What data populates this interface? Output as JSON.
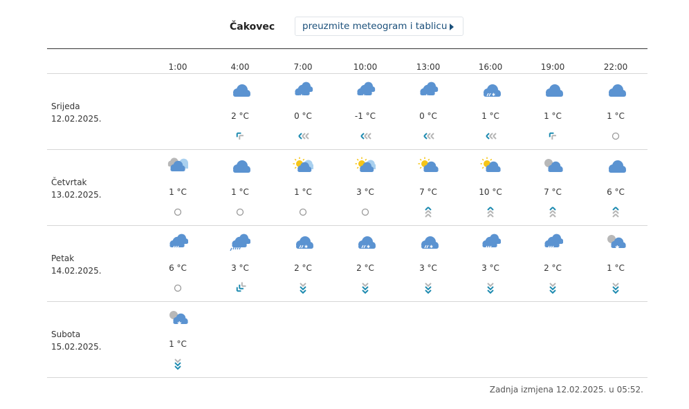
{
  "header": {
    "city": "Čakovec",
    "download_label": "preuzmite meteogram i tablicu"
  },
  "hours": [
    "1:00",
    "4:00",
    "7:00",
    "10:00",
    "13:00",
    "16:00",
    "19:00",
    "22:00"
  ],
  "colors": {
    "cloud": "#5b93d1",
    "sun": "#f5c518",
    "wind_teal": "#1e8bb0",
    "wind_grey": "#b5b5b5"
  },
  "days": [
    {
      "name": "Srijeda",
      "date": "12.02.2025.",
      "cells": [
        null,
        {
          "icon": "cloud-icon",
          "temp": "2 °C",
          "wind": "wind-northwest-icon"
        },
        {
          "icon": "cloudy-snow-icon",
          "temp": "0 °C",
          "wind": "wind-west-strong-icon"
        },
        {
          "icon": "cloudy-snow-icon",
          "temp": "-1 °C",
          "wind": "wind-west-strong-icon"
        },
        {
          "icon": "cloudy-snow-icon",
          "temp": "0 °C",
          "wind": "wind-west-strong-icon"
        },
        {
          "icon": "cloud-sleet-icon",
          "temp": "1 °C",
          "wind": "wind-west-strong-icon"
        },
        {
          "icon": "cloud-icon",
          "temp": "1 °C",
          "wind": "wind-northwest-icon"
        },
        {
          "icon": "cloud-icon",
          "temp": "1 °C",
          "wind": "calm-icon"
        }
      ]
    },
    {
      "name": "Četvrtak",
      "date": "13.02.2025.",
      "cells": [
        {
          "icon": "overcast-icon",
          "temp": "1 °C",
          "wind": "calm-icon"
        },
        {
          "icon": "cloud-icon",
          "temp": "1 °C",
          "wind": "calm-icon"
        },
        {
          "icon": "sun-cloud-icon",
          "temp": "1 °C",
          "wind": "calm-icon"
        },
        {
          "icon": "sun-cloud-icon",
          "temp": "3 °C",
          "wind": "calm-icon"
        },
        {
          "icon": "partly-cloudy-icon",
          "temp": "7 °C",
          "wind": "wind-south-icon"
        },
        {
          "icon": "partly-cloudy-icon",
          "temp": "10 °C",
          "wind": "wind-south-icon"
        },
        {
          "icon": "partly-cloudy-night-icon",
          "temp": "7 °C",
          "wind": "wind-south-icon"
        },
        {
          "icon": "cloud-icon",
          "temp": "6 °C",
          "wind": "wind-south-icon"
        }
      ]
    },
    {
      "name": "Petak",
      "date": "14.02.2025.",
      "cells": [
        {
          "icon": "cloudy-rain-icon",
          "temp": "6 °C",
          "wind": "calm-icon"
        },
        {
          "icon": "cloudy-heavy-rain-icon",
          "temp": "3 °C",
          "wind": "wind-southwest-icon"
        },
        {
          "icon": "cloud-sleet-icon",
          "temp": "2 °C",
          "wind": "wind-north-icon"
        },
        {
          "icon": "cloud-sleet-icon",
          "temp": "2 °C",
          "wind": "wind-north-icon"
        },
        {
          "icon": "cloud-sleet-icon",
          "temp": "3 °C",
          "wind": "wind-north-icon"
        },
        {
          "icon": "cloudy-rain-icon",
          "temp": "3 °C",
          "wind": "wind-north-icon"
        },
        {
          "icon": "cloudy-rain-icon",
          "temp": "2 °C",
          "wind": "wind-north-icon"
        },
        {
          "icon": "partly-cloudy-snow-icon",
          "temp": "1 °C",
          "wind": "wind-north-icon"
        }
      ]
    },
    {
      "name": "Subota",
      "date": "15.02.2025.",
      "cells": [
        {
          "icon": "partly-cloudy-snow-icon",
          "temp": "1 °C",
          "wind": "wind-north-icon"
        },
        null,
        null,
        null,
        null,
        null,
        null,
        null
      ]
    }
  ],
  "footer": {
    "updated": "Zadnja izmjena 12.02.2025. u 05:52."
  }
}
